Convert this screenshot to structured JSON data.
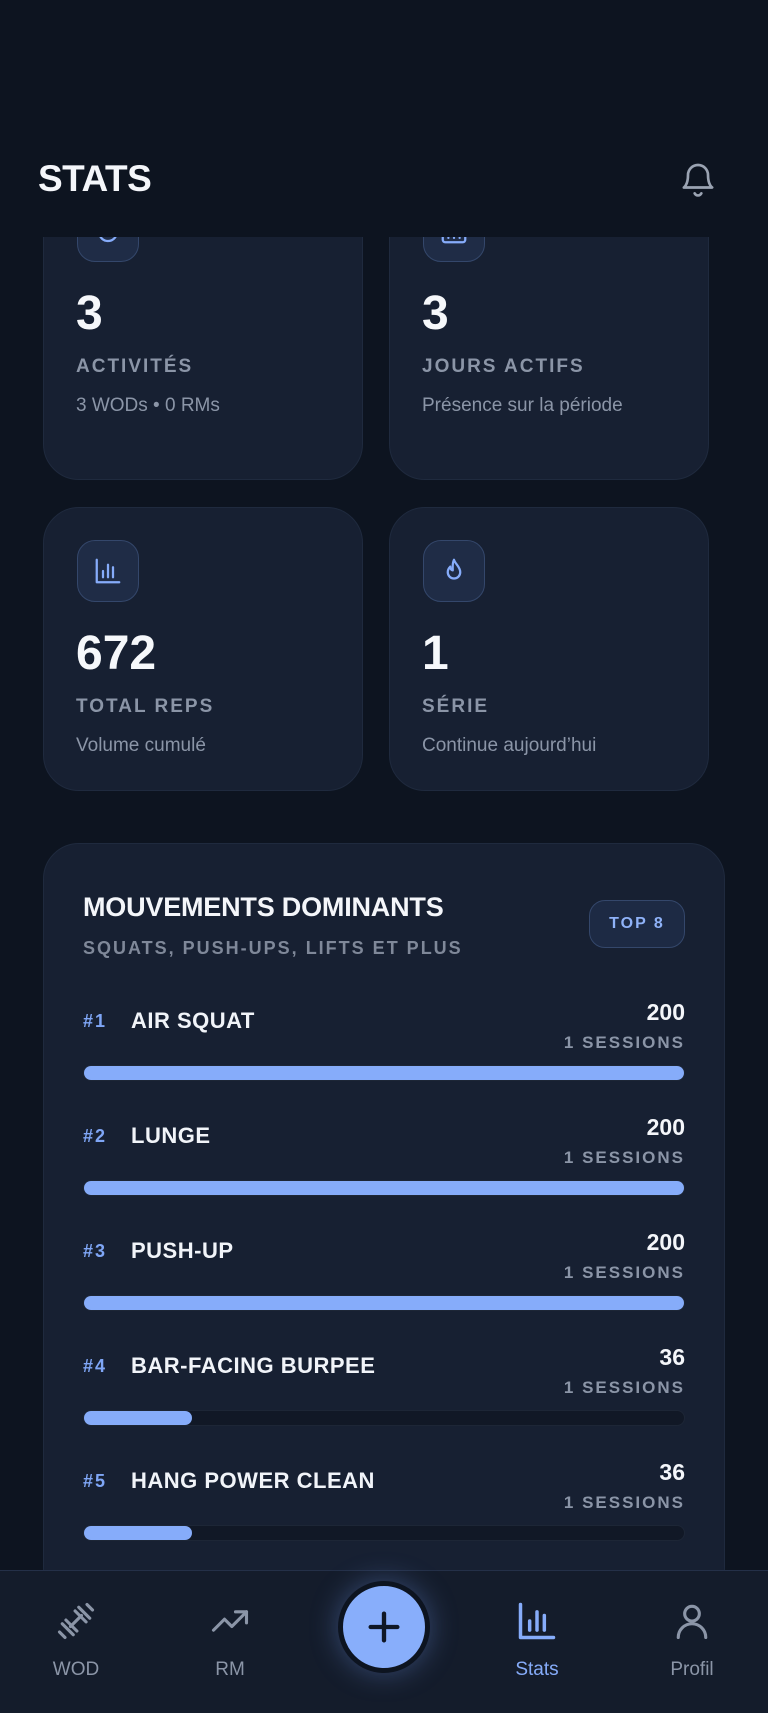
{
  "header": {
    "title": "STATS",
    "bell_icon": "bell-icon"
  },
  "stats": [
    {
      "icon": "timer-icon",
      "value": "3",
      "label": "ACTIVITÉS",
      "sub": "3 WODs • 0 RMs"
    },
    {
      "icon": "calendar-icon",
      "value": "3",
      "label": "JOURS ACTIFS",
      "sub": "Présence sur la période"
    },
    {
      "icon": "bar-chart-icon",
      "value": "672",
      "label": "TOTAL REPS",
      "sub": "Volume cumulé"
    },
    {
      "icon": "flame-icon",
      "value": "1",
      "label": "SÉRIE",
      "sub": "Continue aujourd’hui"
    }
  ],
  "movements": {
    "title": "MOUVEMENTS DOMINANTS",
    "subtitle": "SQUATS, PUSH-UPS, LIFTS ET PLUS",
    "badge": "TOP 8",
    "items": [
      {
        "rank": "#1",
        "name": "AIR SQUAT",
        "value": "200",
        "sessions": "1 SESSIONS",
        "fraction": 1.0
      },
      {
        "rank": "#2",
        "name": "LUNGE",
        "value": "200",
        "sessions": "1 SESSIONS",
        "fraction": 1.0
      },
      {
        "rank": "#3",
        "name": "PUSH-UP",
        "value": "200",
        "sessions": "1 SESSIONS",
        "fraction": 1.0
      },
      {
        "rank": "#4",
        "name": "BAR-FACING BURPEE",
        "value": "36",
        "sessions": "1 SESSIONS",
        "fraction": 0.18
      },
      {
        "rank": "#5",
        "name": "HANG POWER CLEAN",
        "value": "36",
        "sessions": "1 SESSIONS",
        "fraction": 0.18
      }
    ]
  },
  "nav": {
    "items": [
      {
        "label": "WOD",
        "icon": "dumbbell-icon"
      },
      {
        "label": "RM",
        "icon": "trending-up-icon"
      },
      {
        "label": "Stats",
        "icon": "stats-icon",
        "active": true
      },
      {
        "label": "Profil",
        "icon": "user-icon"
      }
    ],
    "fab_icon": "plus-icon"
  },
  "colors": {
    "accent": "#86acfa",
    "background": "#0d1420",
    "card": "#172032",
    "muted": "#8b95a7"
  }
}
